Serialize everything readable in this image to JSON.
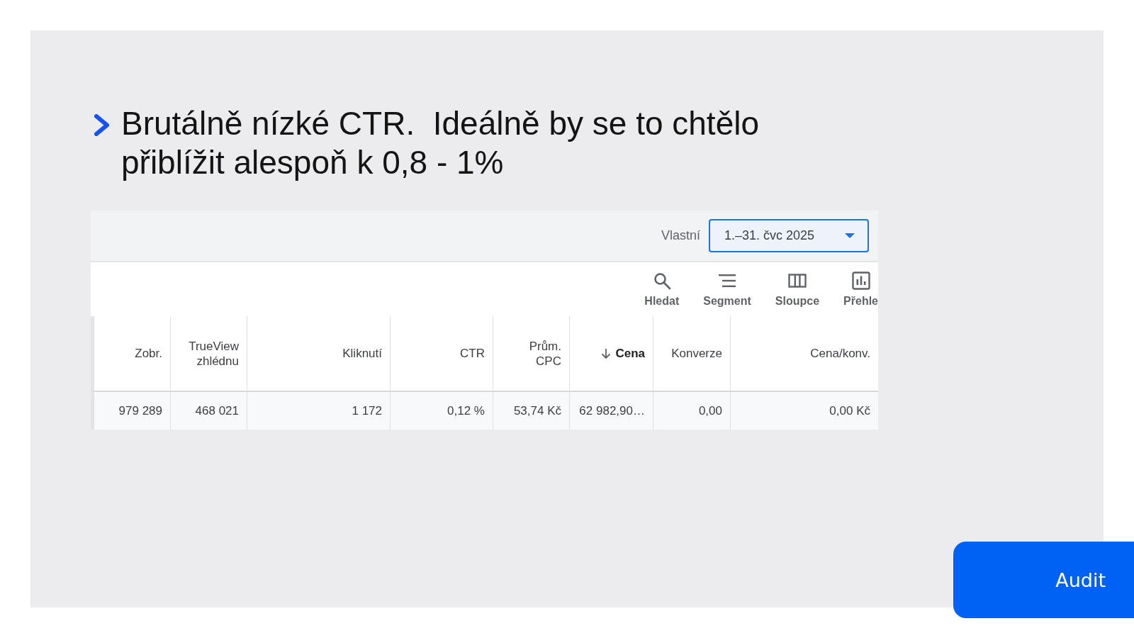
{
  "slide": {
    "heading": "Brutálně nízké CTR.  Ideálně by se to chtělo přiblížit alespoň k 0,8 - 1%"
  },
  "report": {
    "date_range": {
      "label": "Vlastní",
      "value": "1.–31. čvc 2025"
    },
    "toolbar": [
      {
        "kind": "search",
        "label": "Hledat"
      },
      {
        "kind": "segment",
        "label": "Segment"
      },
      {
        "kind": "columns",
        "label": "Sloupce"
      },
      {
        "kind": "report",
        "label": "Přehle"
      }
    ],
    "table": {
      "columns": [
        {
          "label": "Zobr.",
          "sorted": false
        },
        {
          "label": "TrueView zhlédnu",
          "sorted": false
        },
        {
          "label": "Kliknutí",
          "sorted": false
        },
        {
          "label": "CTR",
          "sorted": false
        },
        {
          "label": "Prům. CPC",
          "sorted": false
        },
        {
          "label": "Cena",
          "sorted": true
        },
        {
          "label": "Konverze",
          "sorted": false
        },
        {
          "label": "Cena/konv.",
          "sorted": false
        }
      ],
      "rows": [
        [
          "979 289",
          "468 021",
          "1 172",
          "0,12 %",
          "53,74 Kč",
          "62 982,90…",
          "0,00",
          "0,00 Kč"
        ]
      ]
    }
  },
  "audit_button": {
    "label": "Audit"
  }
}
